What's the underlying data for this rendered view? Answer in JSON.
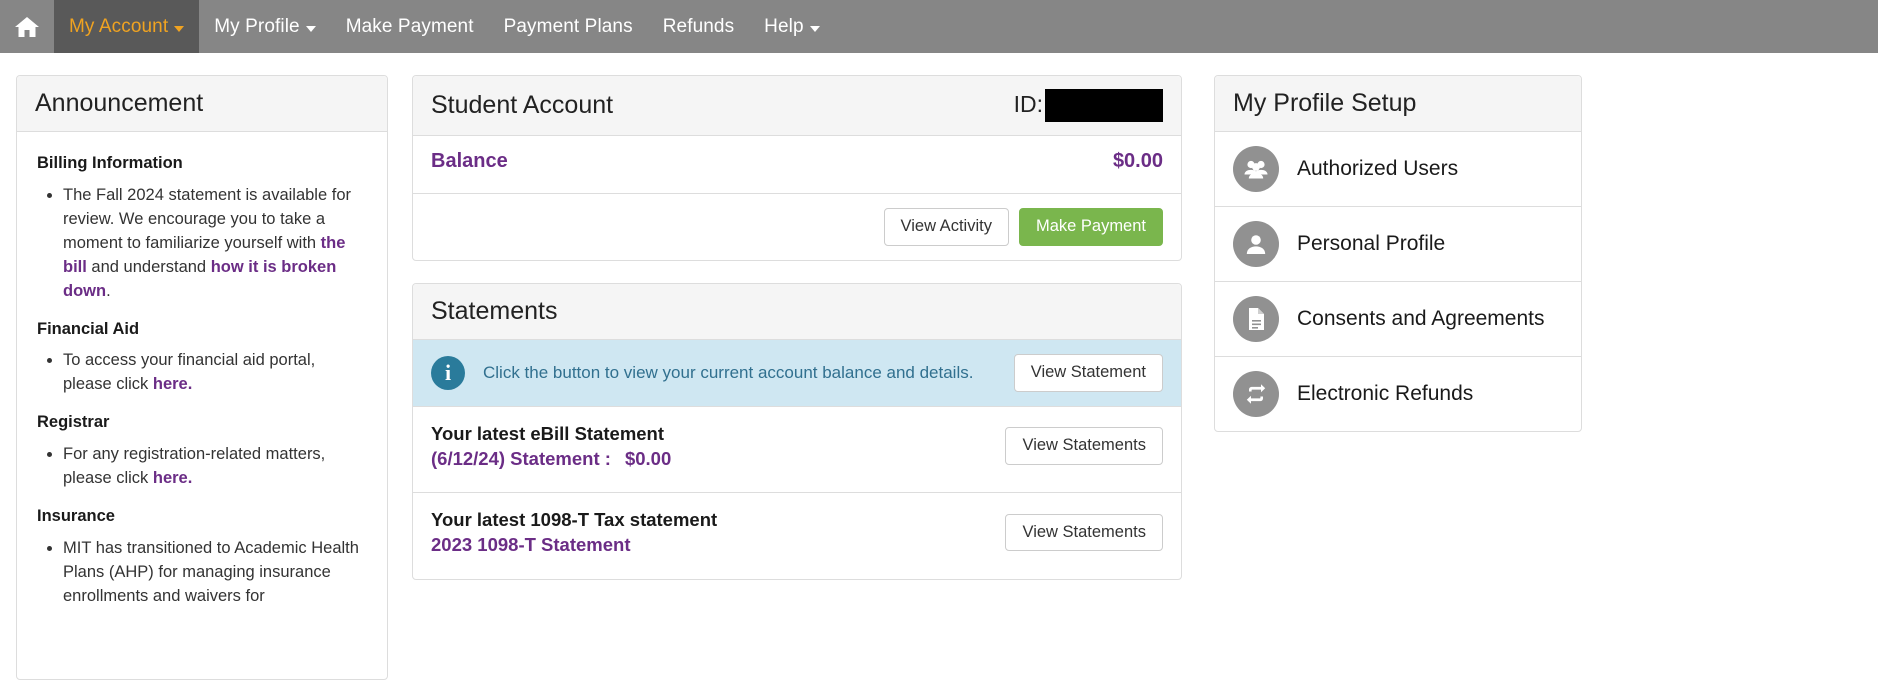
{
  "navbar": {
    "home_icon": "home-icon",
    "items": [
      {
        "label": "My Account",
        "caret": true,
        "active": true
      },
      {
        "label": "My Profile",
        "caret": true,
        "active": false
      },
      {
        "label": "Make Payment",
        "caret": false,
        "active": false
      },
      {
        "label": "Payment Plans",
        "caret": false,
        "active": false
      },
      {
        "label": "Refunds",
        "caret": false,
        "active": false
      },
      {
        "label": "Help",
        "caret": true,
        "active": false
      }
    ],
    "colors": {
      "background": "#868686",
      "active_background": "#595959",
      "active_text": "#f0a321"
    }
  },
  "announcement": {
    "title": "Announcement",
    "sections": [
      {
        "heading": "Billing Information",
        "items": [
          {
            "parts": [
              {
                "text": "The Fall 2024 statement is available for review. We encourage you to take a moment to familiarize yourself with ",
                "link": false
              },
              {
                "text": "the bill",
                "link": true
              },
              {
                "text": " and understand ",
                "link": false
              },
              {
                "text": "how it is broken down",
                "link": true
              },
              {
                "text": ".",
                "link": false
              }
            ]
          }
        ]
      },
      {
        "heading": "Financial Aid",
        "items": [
          {
            "parts": [
              {
                "text": "To access your financial aid portal, please click ",
                "link": false
              },
              {
                "text": "here.",
                "link": true
              }
            ]
          }
        ]
      },
      {
        "heading": "Registrar",
        "items": [
          {
            "parts": [
              {
                "text": "For any registration-related matters, please click ",
                "link": false
              },
              {
                "text": "here.",
                "link": true
              }
            ]
          }
        ]
      },
      {
        "heading": "Insurance",
        "items": [
          {
            "parts": [
              {
                "text": "MIT has transitioned to Academic Health Plans (AHP) for managing insurance enrollments and waivers for",
                "link": false
              }
            ]
          }
        ]
      }
    ]
  },
  "student_account": {
    "title": "Student Account",
    "id_label": "ID:",
    "id_value_redacted": true,
    "balance_label": "Balance",
    "balance_amount": "$0.00",
    "buttons": {
      "view_activity": "View Activity",
      "make_payment": "Make Payment"
    },
    "colors": {
      "link": "#6b2d86",
      "payment_button": "#7ab64d"
    }
  },
  "statements": {
    "title": "Statements",
    "alert": {
      "icon": "info-circle-icon",
      "text": "Click the button to view your current account balance and details.",
      "button": "View Statement",
      "background": "#cfe7f2"
    },
    "rows": [
      {
        "title": "Your latest eBill Statement",
        "subtitle": "(6/12/24) Statement :",
        "amount": "$0.00",
        "button": "View Statements"
      },
      {
        "title": "Your latest 1098-T Tax statement",
        "subtitle": "2023 1098-T Statement",
        "amount": "",
        "button": "View Statements"
      }
    ]
  },
  "profile_setup": {
    "title": "My Profile Setup",
    "items": [
      {
        "label": "Authorized Users",
        "icon": "users-group-icon"
      },
      {
        "label": "Personal Profile",
        "icon": "user-icon"
      },
      {
        "label": "Consents and Agreements",
        "icon": "document-icon"
      },
      {
        "label": "Electronic Refunds",
        "icon": "refund-loop-icon"
      }
    ],
    "icon_background": "#919191"
  }
}
